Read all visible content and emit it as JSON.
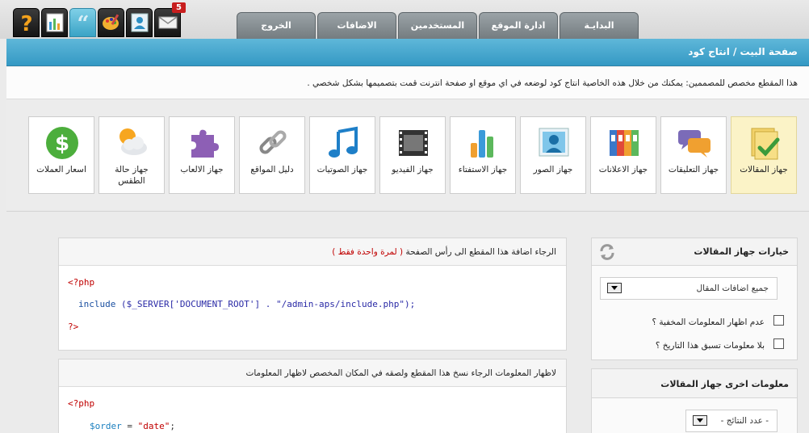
{
  "topbar": {
    "icons": [
      {
        "name": "help-icon"
      },
      {
        "name": "stats-icon"
      },
      {
        "name": "quote-icon"
      },
      {
        "name": "palette-icon"
      },
      {
        "name": "user-card-icon"
      },
      {
        "name": "mail-icon",
        "badge": "5"
      }
    ],
    "tabs": [
      "البدايـة",
      "ادارة الموقع",
      "المستخدمين",
      "الاضافات",
      "الخروج"
    ]
  },
  "header": {
    "title": "صفحة البيت / انتاج كود",
    "description": "هذا المقطع مخصص للمصممين: يمكنك من خلال هذه الخاصية انتاج كود لوضعه في اي موقع او صفحة انترنت قمت بتصميمها بشكل شخصي ."
  },
  "devices": [
    {
      "label": "جهاز المقالات",
      "icon": "articles-icon",
      "selected": true
    },
    {
      "label": "جهاز التعليقات",
      "icon": "comments-icon"
    },
    {
      "label": "جهاز الاعلانات",
      "icon": "ads-icon"
    },
    {
      "label": "جهاز الصور",
      "icon": "photos-icon"
    },
    {
      "label": "جهاز الاستفتاء",
      "icon": "poll-icon"
    },
    {
      "label": "جهاز الفيديو",
      "icon": "video-icon"
    },
    {
      "label": "جهاز الصوتيات",
      "icon": "audio-icon"
    },
    {
      "label": "دليل المواقع",
      "icon": "links-icon"
    },
    {
      "label": "جهاز الالعاب",
      "icon": "games-icon"
    },
    {
      "label": "جهاز حالة الطقس",
      "icon": "weather-icon"
    },
    {
      "label": "اسعار العملات",
      "icon": "currency-icon"
    }
  ],
  "options_panel": {
    "title": "خيارات جهاز المقالات",
    "select_value": "جميع اضافات المقال",
    "checkbox1": "عدم اظهار المعلومات المخفية ؟",
    "checkbox2": "بلا معلومات تسبق هذا التاريخ ؟"
  },
  "more_panel": {
    "title": "معلومات اخرى جهاز المقالات",
    "results_label": "- عدد النتائج -"
  },
  "code_panel_1": {
    "title": "الرجاء اضافة هذا المقطع الى رأس الصفحة",
    "note": "( لمرة واحدة فقط )",
    "line1": "<?php",
    "include_kw": "include",
    "include_args": " ($_SERVER['DOCUMENT_ROOT'] . \"/admin-aps/include.php\");",
    "line3": "?>"
  },
  "code_panel_2": {
    "title": "لاظهار المعلومات الرجاء نسخ هذا المقطع ولصقه في المكان المخصص لاظهار المعلومات",
    "line1": "<?php",
    "var": "$order",
    "eq": " = ",
    "val": "\"date\"",
    "semi": ";"
  }
}
